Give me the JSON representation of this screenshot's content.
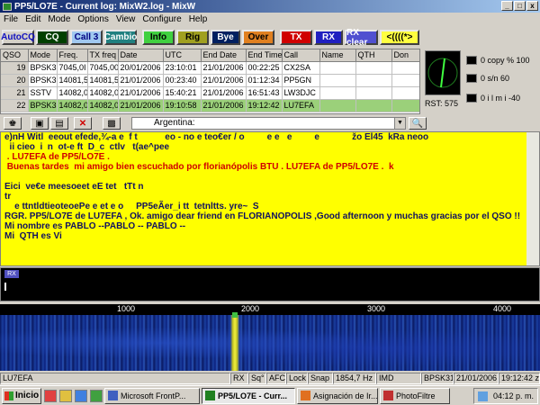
{
  "window": {
    "title": "PP5/LO7E - Current log: MixW2.log - MixW"
  },
  "menu": [
    "File",
    "Edit",
    "Mode",
    "Options",
    "View",
    "Configure",
    "Help"
  ],
  "macros": [
    {
      "label": "AutoCQ",
      "bg": "#d4d0c8",
      "fg": "#1010c0"
    },
    {
      "label": "CQ",
      "bg": "#004000",
      "fg": "#ffffff"
    },
    {
      "label": "Call 3",
      "bg": "#a0c8f0",
      "fg": "#000080"
    },
    {
      "label": "Cambio",
      "bg": "#208080",
      "fg": "#ffffff"
    },
    {
      "label": "Info",
      "bg": "#40d040",
      "fg": "#000000"
    },
    {
      "label": "Rig",
      "bg": "#a0a020",
      "fg": "#000000"
    },
    {
      "label": "Bye",
      "bg": "#002060",
      "fg": "#ffffff"
    },
    {
      "label": "Over",
      "bg": "#e08020",
      "fg": "#000000"
    },
    {
      "label": "TX",
      "bg": "#d00000",
      "fg": "#ffffff"
    },
    {
      "label": "RX",
      "bg": "#2020c0",
      "fg": "#ffffff"
    },
    {
      "label": "RX clear",
      "bg": "#5050d0",
      "fg": "#ffffff"
    },
    {
      "label": "<((((*>",
      "bg": "#ffff40",
      "fg": "#000000"
    }
  ],
  "log": {
    "headers": [
      "QSO",
      "Mode",
      "Freq.",
      "TX freq",
      "Date",
      "UTC",
      "End Date",
      "End Time",
      "Call",
      "Name",
      "QTH",
      "Don"
    ],
    "rows": [
      [
        "19",
        "BPSK3",
        "7045,0I",
        "7045,00",
        "20/01/2006",
        "23:10:01",
        "21/01/2006",
        "00:22:25",
        "CX2SA",
        "",
        "",
        ""
      ],
      [
        "20",
        "BPSK3",
        "14081,5",
        "14081,5",
        "21/01/2006",
        "00:23:40",
        "21/01/2006",
        "01:12:34",
        "PP5GN",
        "",
        "",
        ""
      ],
      [
        "21",
        "SSTV",
        "14082,0",
        "14082,0",
        "21/01/2006",
        "15:40:21",
        "21/01/2006",
        "16:51:43",
        "LW3DJC",
        "",
        "",
        ""
      ],
      [
        "22",
        "BPSK3",
        "14082,0",
        "14082,0",
        "21/01/2006",
        "19:10:58",
        "21/01/2006",
        "19:12:42",
        "LU7EFA",
        "",
        "",
        ""
      ]
    ]
  },
  "indicators": {
    "copy": "0  copy %   100",
    "sn": "0     s/n     60",
    "lm": "0  i  l  m  i -40",
    "rst": "RST: 575"
  },
  "toolbar": {
    "country": "Argentina:"
  },
  "rx_lines": [
    {
      "t": "e)nH Witl  eeout efede,¾-a e  f t           eo - no e teo€er / o         e e   e         e             žo El45  kRa neoo",
      "c": "dark"
    },
    {
      "t": "  ii cieo  i  n  ot-e ft  D_c  ctlv   t(ae^pee",
      "c": "dark"
    },
    {
      "t": " . LU7EFA de PP5/LO7E .",
      "c": "red"
    },
    {
      "t": " Buenas tardes  mi amigo bien escuchado por florianópolis BTU . LU7EFA de PP5/LO7E .  k",
      "c": "red"
    },
    {
      "t": "",
      "c": "dark"
    },
    {
      "t": "Eici  ve€e meesoeet eE tet   tTt n",
      "c": "dark"
    },
    {
      "t": "tr",
      "c": "dark"
    },
    {
      "t": "    e ttntldtieoteoePe e et e o     PP5eÃer_i tt  tetnltts. yre~  S",
      "c": "dark"
    },
    {
      "t": "RGR. PP5/LO7E de LU7EFA , Ok. amigo dear friend en FLORIANOPOLIS ,Good afternoon y muchas gracias por el QSO !!",
      "c": "dark"
    },
    {
      "t": "Mi nombre es PABLO --PABLO -- PABLO --",
      "c": "dark"
    },
    {
      "t": "Mi  QTH es Vi",
      "c": "dark"
    }
  ],
  "tx": {
    "label": "RX"
  },
  "ruler": [
    "1000",
    "2000",
    "3000",
    "4000"
  ],
  "status": [
    "LU7EFA",
    "RX",
    "Sq°",
    "AFC",
    "Lock",
    "Snap",
    "1854,7 Hz",
    "IMD",
    "BPSK31",
    "21/01/2006",
    "19:12:42 z"
  ],
  "taskbar": {
    "start": "Inicio",
    "tasks": [
      "Microsoft FrontP...",
      "PP5/LO7E - Curr...",
      "Asignación de Ir...",
      "PhotoFiltre"
    ],
    "clock": "04:12 p. m."
  }
}
